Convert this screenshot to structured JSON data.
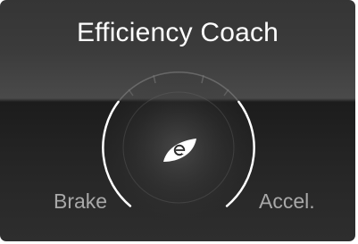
{
  "screen": {
    "title": "Efficiency Coach",
    "left_label": "Brake",
    "right_label": "Accel."
  },
  "gauge": {
    "center_icon": "eco-leaf-icon",
    "level": 0
  },
  "colors": {
    "background_top": "#3b3b3b",
    "background_bottom": "#262626",
    "title_text": "#ffffff",
    "label_text": "#a8a8a8",
    "arc": "#ffffff"
  }
}
